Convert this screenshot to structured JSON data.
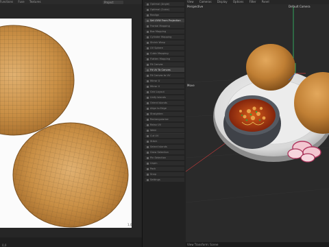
{
  "uv_editor": {
    "menu": [
      "Functions",
      "Fuse",
      "Textures"
    ],
    "dropdown": "Project",
    "corner_label": "1,0",
    "bottom_label": "0,0"
  },
  "tool_panel": {
    "items": [
      {
        "label": "Optimal (Angle)",
        "highlight": false
      },
      {
        "label": "Optimal (Cubic)",
        "highlight": false
      },
      {
        "label": "Realign",
        "highlight": false
      },
      {
        "label": "Set UVW From Projection",
        "highlight": true
      },
      {
        "label": "Frontal Mapping",
        "highlight": false
      },
      {
        "label": "Box Mapping",
        "highlight": false
      },
      {
        "label": "Cylinder Mapping",
        "highlight": false
      },
      {
        "label": "Shrink Wrap",
        "highlight": false
      },
      {
        "label": "UV Sphere",
        "highlight": false
      },
      {
        "label": "Cubic Mapping",
        "highlight": false
      },
      {
        "label": "Flatten Mapping",
        "highlight": false
      },
      {
        "label": "Fit Canvas",
        "highlight": false
      },
      {
        "label": "Fit UV To Canvas",
        "highlight": true
      },
      {
        "label": "Fit Canvas to UV",
        "highlight": false
      },
      {
        "label": "Mirror U",
        "highlight": false
      },
      {
        "label": "Mirror V",
        "highlight": false
      },
      {
        "label": "Grid Layout",
        "highlight": false
      },
      {
        "label": "Unify Islands",
        "highlight": false
      },
      {
        "label": "Orient Islands",
        "highlight": false
      },
      {
        "label": "Align to Edge",
        "highlight": false
      },
      {
        "label": "Straighten",
        "highlight": false
      },
      {
        "label": "Rectangularize",
        "highlight": false
      },
      {
        "label": "Relax UV",
        "highlight": false
      },
      {
        "label": "Weld",
        "highlight": false
      },
      {
        "label": "Cut UV",
        "highlight": false
      },
      {
        "label": "Stitch",
        "highlight": false
      },
      {
        "label": "Select Islands",
        "highlight": false
      },
      {
        "label": "Grow Selection",
        "highlight": false
      },
      {
        "label": "Pin Selection",
        "highlight": false
      },
      {
        "label": "Unpin",
        "highlight": false
      },
      {
        "label": "Pack",
        "highlight": false
      },
      {
        "label": "Snap",
        "highlight": false
      },
      {
        "label": "Settings",
        "highlight": false
      }
    ]
  },
  "viewport": {
    "menu": [
      "View",
      "Cameras",
      "Display",
      "Options",
      "Filter",
      "Panel"
    ],
    "view_name": "Perspective",
    "camera": "Default Camera",
    "move_label": "Move",
    "footer": "View Transform: Scene"
  }
}
